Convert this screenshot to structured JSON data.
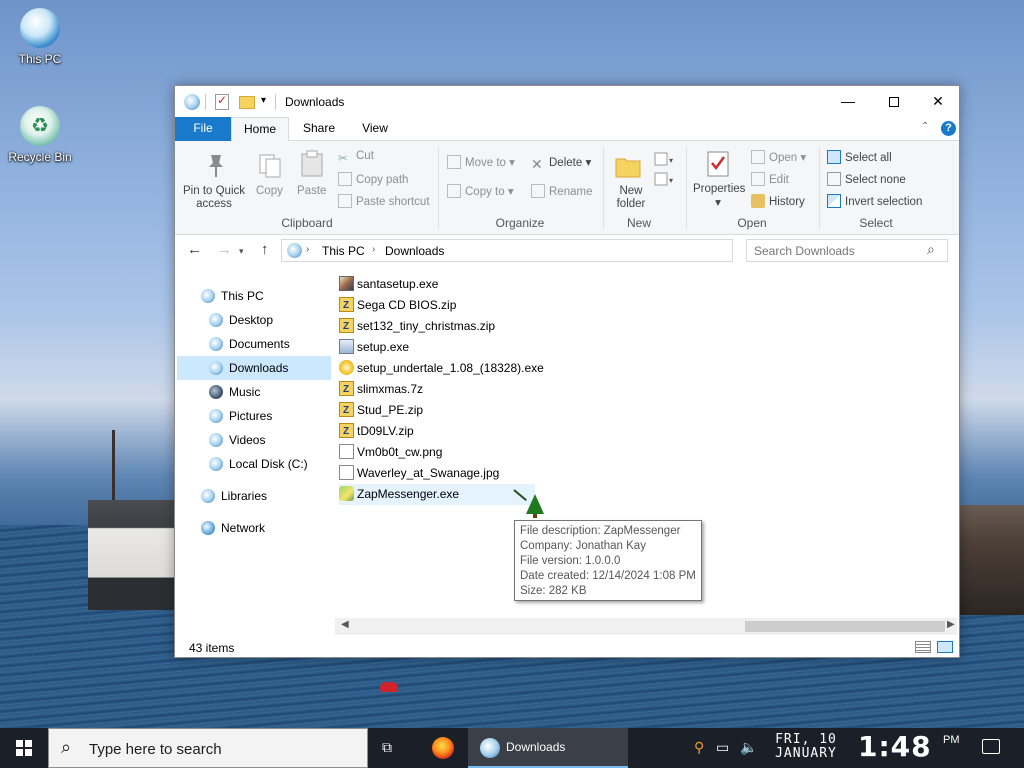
{
  "desktop": {
    "icons": [
      {
        "label": "This PC"
      },
      {
        "label": "Recycle Bin"
      }
    ]
  },
  "window": {
    "title": "Downloads",
    "controls": {
      "minimize": "—",
      "maximize": "",
      "close": "✕"
    },
    "tabs": {
      "file": "File",
      "home": "Home",
      "share": "Share",
      "view": "View"
    },
    "ribbon": {
      "clipboard": {
        "pin": "Pin to Quick access",
        "copy": "Copy",
        "paste": "Paste",
        "cut": "Cut",
        "copy_path": "Copy path",
        "paste_shortcut": "Paste shortcut",
        "label": "Clipboard"
      },
      "organize": {
        "move_to": "Move to",
        "copy_to": "Copy to",
        "delete": "Delete",
        "rename": "Rename",
        "label": "Organize"
      },
      "new": {
        "new_folder": "New folder",
        "label": "New"
      },
      "open": {
        "properties": "Properties",
        "open": "Open",
        "edit": "Edit",
        "history": "History",
        "label": "Open"
      },
      "select": {
        "select_all": "Select all",
        "select_none": "Select none",
        "invert_selection": "Invert selection",
        "label": "Select"
      }
    },
    "address": {
      "crumbs": [
        "This PC",
        "Downloads"
      ],
      "search_placeholder": "Search Downloads"
    },
    "nav_pane": [
      {
        "label": "This PC"
      },
      {
        "label": "Desktop"
      },
      {
        "label": "Documents"
      },
      {
        "label": "Downloads",
        "selected": true
      },
      {
        "label": "Music"
      },
      {
        "label": "Pictures"
      },
      {
        "label": "Videos"
      },
      {
        "label": "Local Disk (C:)"
      },
      {
        "label": "Libraries"
      },
      {
        "label": "Network"
      }
    ],
    "files": [
      {
        "name": "santasetup.exe",
        "icon": "exe-icon"
      },
      {
        "name": "Sega CD BIOS.zip",
        "icon": "zip-icon"
      },
      {
        "name": "set132_tiny_christmas.zip",
        "icon": "zip-icon"
      },
      {
        "name": "setup.exe",
        "icon": "setup-icon"
      },
      {
        "name": "setup_undertale_1.08_(18328).exe",
        "icon": "undertale-icon"
      },
      {
        "name": "slimxmas.7z",
        "icon": "zip-icon"
      },
      {
        "name": "Stud_PE.zip",
        "icon": "zip-icon"
      },
      {
        "name": "tD09LV.zip",
        "icon": "zip-icon"
      },
      {
        "name": "Vm0b0t_cw.png",
        "icon": "image-icon"
      },
      {
        "name": "Waverley_at_Swanage.jpg",
        "icon": "image-icon"
      },
      {
        "name": "ZapMessenger.exe",
        "icon": "zapmessenger-icon"
      }
    ],
    "tooltip": {
      "description": "File description: ZapMessenger",
      "company": "Company: Jonathan Kay",
      "version": "File version: 1.0.0.0",
      "created": "Date created: 12/14/2024 1:08 PM",
      "size": "Size: 282 KB"
    },
    "status": {
      "item_count": "43 items"
    }
  },
  "taskbar": {
    "search_placeholder": "Type here to search",
    "open_app": "Downloads",
    "date_line1": "FRI, 10",
    "date_line2": "JANUARY",
    "time": "1:48",
    "ampm": "PM"
  }
}
